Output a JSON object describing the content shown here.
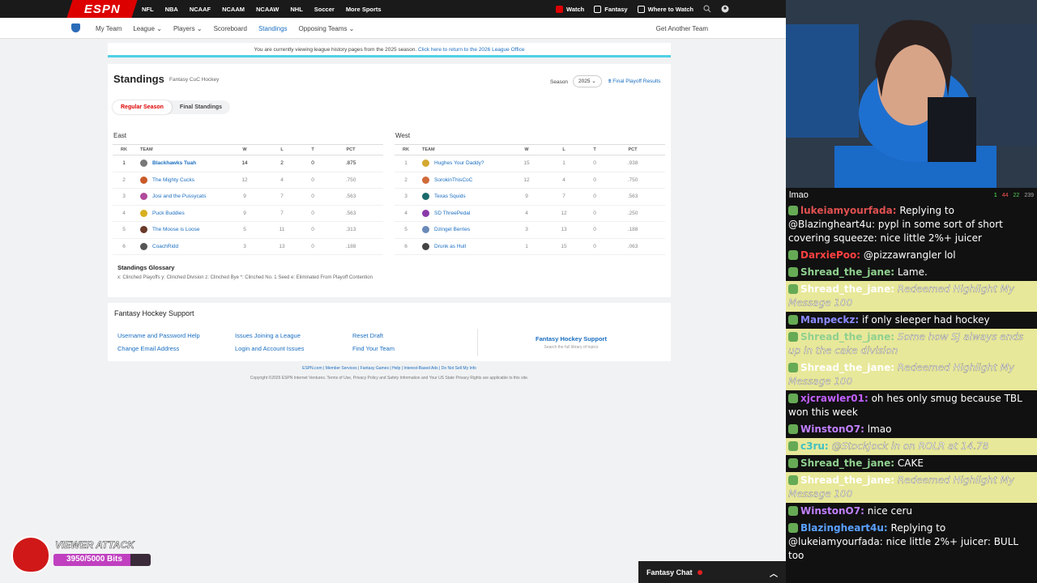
{
  "topbar": {
    "logo": "ESPN",
    "sports": [
      "NFL",
      "NBA",
      "NCAAF",
      "NCAAM",
      "NCAAW",
      "NHL",
      "Soccer",
      "More Sports"
    ],
    "watch": "Watch",
    "fantasy": "Fantasy",
    "where_to_watch": "Where to Watch"
  },
  "fnav": {
    "items": [
      "My Team",
      "League",
      "Players",
      "Scoreboard",
      "Standings",
      "Opposing Teams"
    ],
    "active": "Standings",
    "another": "Get Another Team"
  },
  "banner": {
    "text": "You are currently viewing league history pages from the 2025 season.",
    "link": "Click here to return to the 2026 League Office"
  },
  "standings": {
    "title": "Standings",
    "league": "Fantasy CuC Hockey",
    "season_label": "Season",
    "season_value": "2025",
    "playoff_link": "Final Playoff Results",
    "tabs": [
      "Regular Season",
      "Final Standings"
    ],
    "headers": [
      "RK",
      "TEAM",
      "W",
      "L",
      "T",
      "PCT"
    ],
    "east": {
      "name": "East",
      "rows": [
        {
          "rk": "1",
          "team": "Blackhawks Tuah",
          "w": "14",
          "l": "2",
          "t": "0",
          "pct": ".875"
        },
        {
          "rk": "2",
          "team": "The Mighty Cucks",
          "w": "12",
          "l": "4",
          "t": "0",
          "pct": ".750"
        },
        {
          "rk": "3",
          "team": "Josi and the Pussycats",
          "w": "9",
          "l": "7",
          "t": "0",
          "pct": ".563"
        },
        {
          "rk": "4",
          "team": "Puck Buddies",
          "w": "9",
          "l": "7",
          "t": "0",
          "pct": ".563"
        },
        {
          "rk": "5",
          "team": "The Moose is Loose",
          "w": "5",
          "l": "11",
          "t": "0",
          "pct": ".313"
        },
        {
          "rk": "6",
          "team": "CoachRidd",
          "w": "3",
          "l": "13",
          "t": "0",
          "pct": ".188"
        }
      ]
    },
    "west": {
      "name": "West",
      "rows": [
        {
          "rk": "1",
          "team": "Hughes Your Daddy?",
          "w": "15",
          "l": "1",
          "t": "0",
          "pct": ".938"
        },
        {
          "rk": "2",
          "team": "SorokinThisCoC",
          "w": "12",
          "l": "4",
          "t": "0",
          "pct": ".750"
        },
        {
          "rk": "3",
          "team": "Texas Squids",
          "w": "9",
          "l": "7",
          "t": "0",
          "pct": ".563"
        },
        {
          "rk": "4",
          "team": "SD ThreePedal",
          "w": "4",
          "l": "12",
          "t": "0",
          "pct": ".250"
        },
        {
          "rk": "5",
          "team": "Dzingel Berries",
          "w": "3",
          "l": "13",
          "t": "0",
          "pct": ".188"
        },
        {
          "rk": "6",
          "team": "Drunk as Hull",
          "w": "1",
          "l": "15",
          "t": "0",
          "pct": ".063"
        }
      ]
    },
    "glossary": {
      "title": "Standings Glossary",
      "items": "x: Clinched Playoffs   y: Clinched Division   z: Clinched Bye   *: Clinched No. 1 Seed   e: Eliminated From Playoff Contention"
    }
  },
  "support": {
    "title": "Fantasy Hockey Support",
    "col1": [
      "Username and Password Help",
      "Change Email Address"
    ],
    "col2": [
      "Issues Joining a League",
      "Login and Account Issues"
    ],
    "col3": [
      "Reset Draft",
      "Find Your Team"
    ],
    "right_title": "Fantasy Hockey Support",
    "right_sub": "Search the full library of topics"
  },
  "footer": {
    "links": "ESPN.com | Member Services | Fantasy Games | Help | Interest-Based Ads | Do Not Sell My Info",
    "copyright": "Copyright ©2026 ESPN Internet Ventures. Terms of Use, Privacy Policy and Safety Information and Your US State Privacy Rights are applicable to this site."
  },
  "chat": {
    "top_text": "lmao",
    "stats": [
      "1",
      "44",
      "22",
      "239"
    ],
    "messages": [
      {
        "user": "lukeiamyourfada:",
        "text": "Replying to @Blazingheart4u: pypl in some sort of short covering squeeze:  nice little 2%+ juicer",
        "color": "#e05050",
        "hl": false
      },
      {
        "user": "DarxiePoo:",
        "text": "@pizzawrangler lol",
        "color": "#ff4040",
        "hl": false
      },
      {
        "user": "Shread_the_jane:",
        "text": "Lame.",
        "color": "#8fd08f",
        "hl": false
      },
      {
        "user": "Shread_the_jane:",
        "text": "Redeemed Highlight My Message 100",
        "color": "#ffffff",
        "hl": true
      },
      {
        "user": "Manpeckz:",
        "text": "if only sleeper had hockey",
        "color": "#8a8aff",
        "hl": false
      },
      {
        "user": "Shread_the_jane:",
        "text": "Some how SJ always ends up in the cake division",
        "color": "#8fd08f",
        "hl": true
      },
      {
        "user": "Shread_the_jane:",
        "text": "Redeemed Highlight My Message 100",
        "color": "#ffffff",
        "hl": true
      },
      {
        "user": "xjcrawler01:",
        "text": "oh hes only smug because TBL won this week",
        "color": "#c060ff",
        "hl": false
      },
      {
        "user": "WinstonO7:",
        "text": "lmao",
        "color": "#c080ff",
        "hl": false
      },
      {
        "user": "c3ru:",
        "text": "@StockJock in on ROLR at 14.78",
        "color": "#40c0c0",
        "hl": true
      },
      {
        "user": "Shread_the_jane:",
        "text": "CAKE",
        "color": "#8fd08f",
        "hl": false
      },
      {
        "user": "Shread_the_jane:",
        "text": "Redeemed Highlight My Message 100",
        "color": "#ffffff",
        "hl": true
      },
      {
        "user": "WinstonO7:",
        "text": "nice ceru",
        "color": "#c080ff",
        "hl": false
      },
      {
        "user": "Blazingheart4u:",
        "text": "Replying to @lukeiamyourfada: nice little 2%+ juicer: BULL too",
        "color": "#5aa0ff",
        "hl": false
      }
    ]
  },
  "fantasy_chat": "Fantasy Chat",
  "viewer_attack": {
    "title": "VIEWER ATTACK",
    "bits": "3950/5000 Bits",
    "progress": 0.79
  }
}
